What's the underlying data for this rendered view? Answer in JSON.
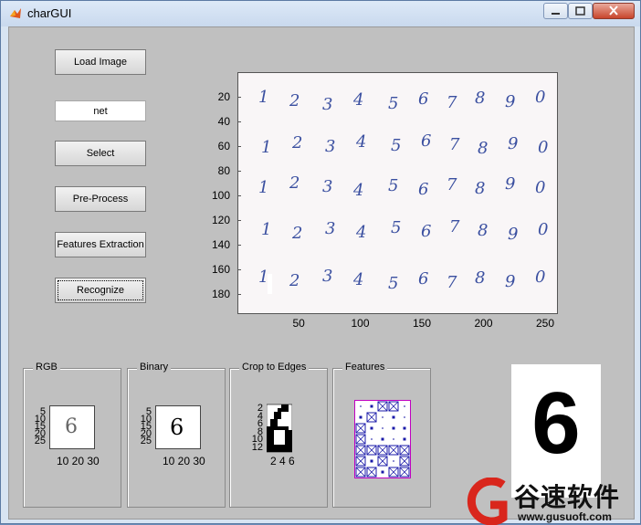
{
  "window": {
    "title": "charGUI"
  },
  "buttons": {
    "load_image": "Load Image",
    "select": "Select",
    "preprocess": "Pre-Process",
    "features": "Features Extraction",
    "recognize": "Recognize"
  },
  "net_field": {
    "value": "net"
  },
  "main_axes": {
    "y_ticks": [
      "20",
      "40",
      "60",
      "80",
      "100",
      "120",
      "140",
      "160",
      "180"
    ],
    "x_ticks": [
      "50",
      "100",
      "150",
      "200",
      "250"
    ],
    "rows": [
      [
        "1",
        "2",
        "3",
        "4",
        "5",
        "6",
        "7",
        "8",
        "9",
        "0"
      ],
      [
        "1",
        "2",
        "3",
        "4",
        "5",
        "6",
        "7",
        "8",
        "9",
        "0"
      ],
      [
        "1",
        "2",
        "3",
        "4",
        "5",
        "6",
        "7",
        "8",
        "9",
        "0"
      ],
      [
        "1",
        "2",
        "3",
        "4",
        "5",
        "6",
        "7",
        "8",
        "9",
        "0"
      ],
      [
        "1",
        "2",
        "3",
        "4",
        "5",
        "6",
        "7",
        "8",
        "9",
        "0"
      ]
    ]
  },
  "panels": {
    "rgb": {
      "title": "RGB",
      "y_ticks": [
        "5",
        "10",
        "15",
        "20",
        "25"
      ],
      "x_ticks": "10 20 30",
      "digit": "6"
    },
    "binary": {
      "title": "Binary",
      "y_ticks": [
        "5",
        "10",
        "15",
        "20",
        "25"
      ],
      "x_ticks": "10 20 30",
      "digit": "6"
    },
    "crop": {
      "title": "Crop to Edges",
      "y_ticks": [
        "2",
        "4",
        "6",
        "8",
        "10",
        "12"
      ],
      "x_ticks": "2 4 6"
    },
    "features": {
      "title": "Features"
    }
  },
  "result": {
    "digit": "6"
  },
  "watermark": {
    "brand_cn": "谷速软件",
    "url": "www.gusuoft.com"
  },
  "colors": {
    "ink": "#3a4fa0",
    "feature_blue": "#1a1aa8",
    "feature_border": "#c000c0"
  }
}
